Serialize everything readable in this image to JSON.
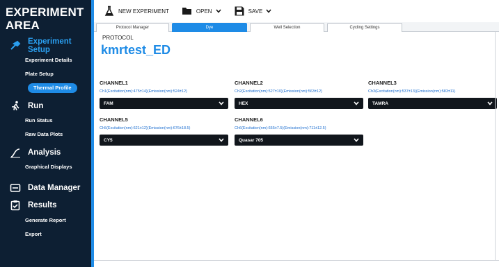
{
  "sidebar": {
    "title": "EXPERIMENT AREA",
    "sections": [
      {
        "label": "Experiment Setup",
        "items": [
          "Experiment Details",
          "Plate Setup",
          "Thermal Profile"
        ]
      },
      {
        "label": "Run",
        "items": [
          "Run Status",
          "Raw Data Plots"
        ]
      },
      {
        "label": "Analysis",
        "items": [
          "Graphical Displays"
        ]
      },
      {
        "label": "Data Manager",
        "items": []
      },
      {
        "label": "Results",
        "items": [
          "Generate Report",
          "Export"
        ]
      }
    ],
    "active_section": "Experiment Setup",
    "selected_item": "Thermal Profile"
  },
  "toolbar": {
    "new_label": "NEW EXPERIMENT",
    "open_label": "OPEN",
    "save_label": "SAVE"
  },
  "tabs": [
    "Protocol Manager",
    "Dye",
    "Well Selection",
    "Cycling Settings"
  ],
  "active_tab": "Dye",
  "main": {
    "protocol_label": "PROTOCOL",
    "protocol_name": "kmrtest_ED",
    "channels": [
      {
        "title": "CHANNEL1",
        "desc": "Ch1(Excitation(nm):475±14)(Emission(nm):524±12)",
        "value": "FAM"
      },
      {
        "title": "CHANNEL2",
        "desc": "Ch2(Excitation(nm):527±10)(Emission(nm):563±12)",
        "value": "HEX"
      },
      {
        "title": "CHANNEL3",
        "desc": "Ch3(Excitation(nm):537±13)(Emission(nm):583±11)",
        "value": "TAMRA"
      },
      {
        "title": "CHANNEL5",
        "desc": "Ch5(Excitation(nm):621±12)(Emission(nm):676±18.5)",
        "value": "CY5"
      },
      {
        "title": "CHANNEL6",
        "desc": "Ch6(Excitation(nm):655±7.5)(Emission(nm):711±12.5)",
        "value": "Quasar 705"
      }
    ]
  },
  "colors": {
    "sidebar_bg": "#0d1f33",
    "accent": "#1e8be6",
    "select_bg": "#11161c"
  }
}
